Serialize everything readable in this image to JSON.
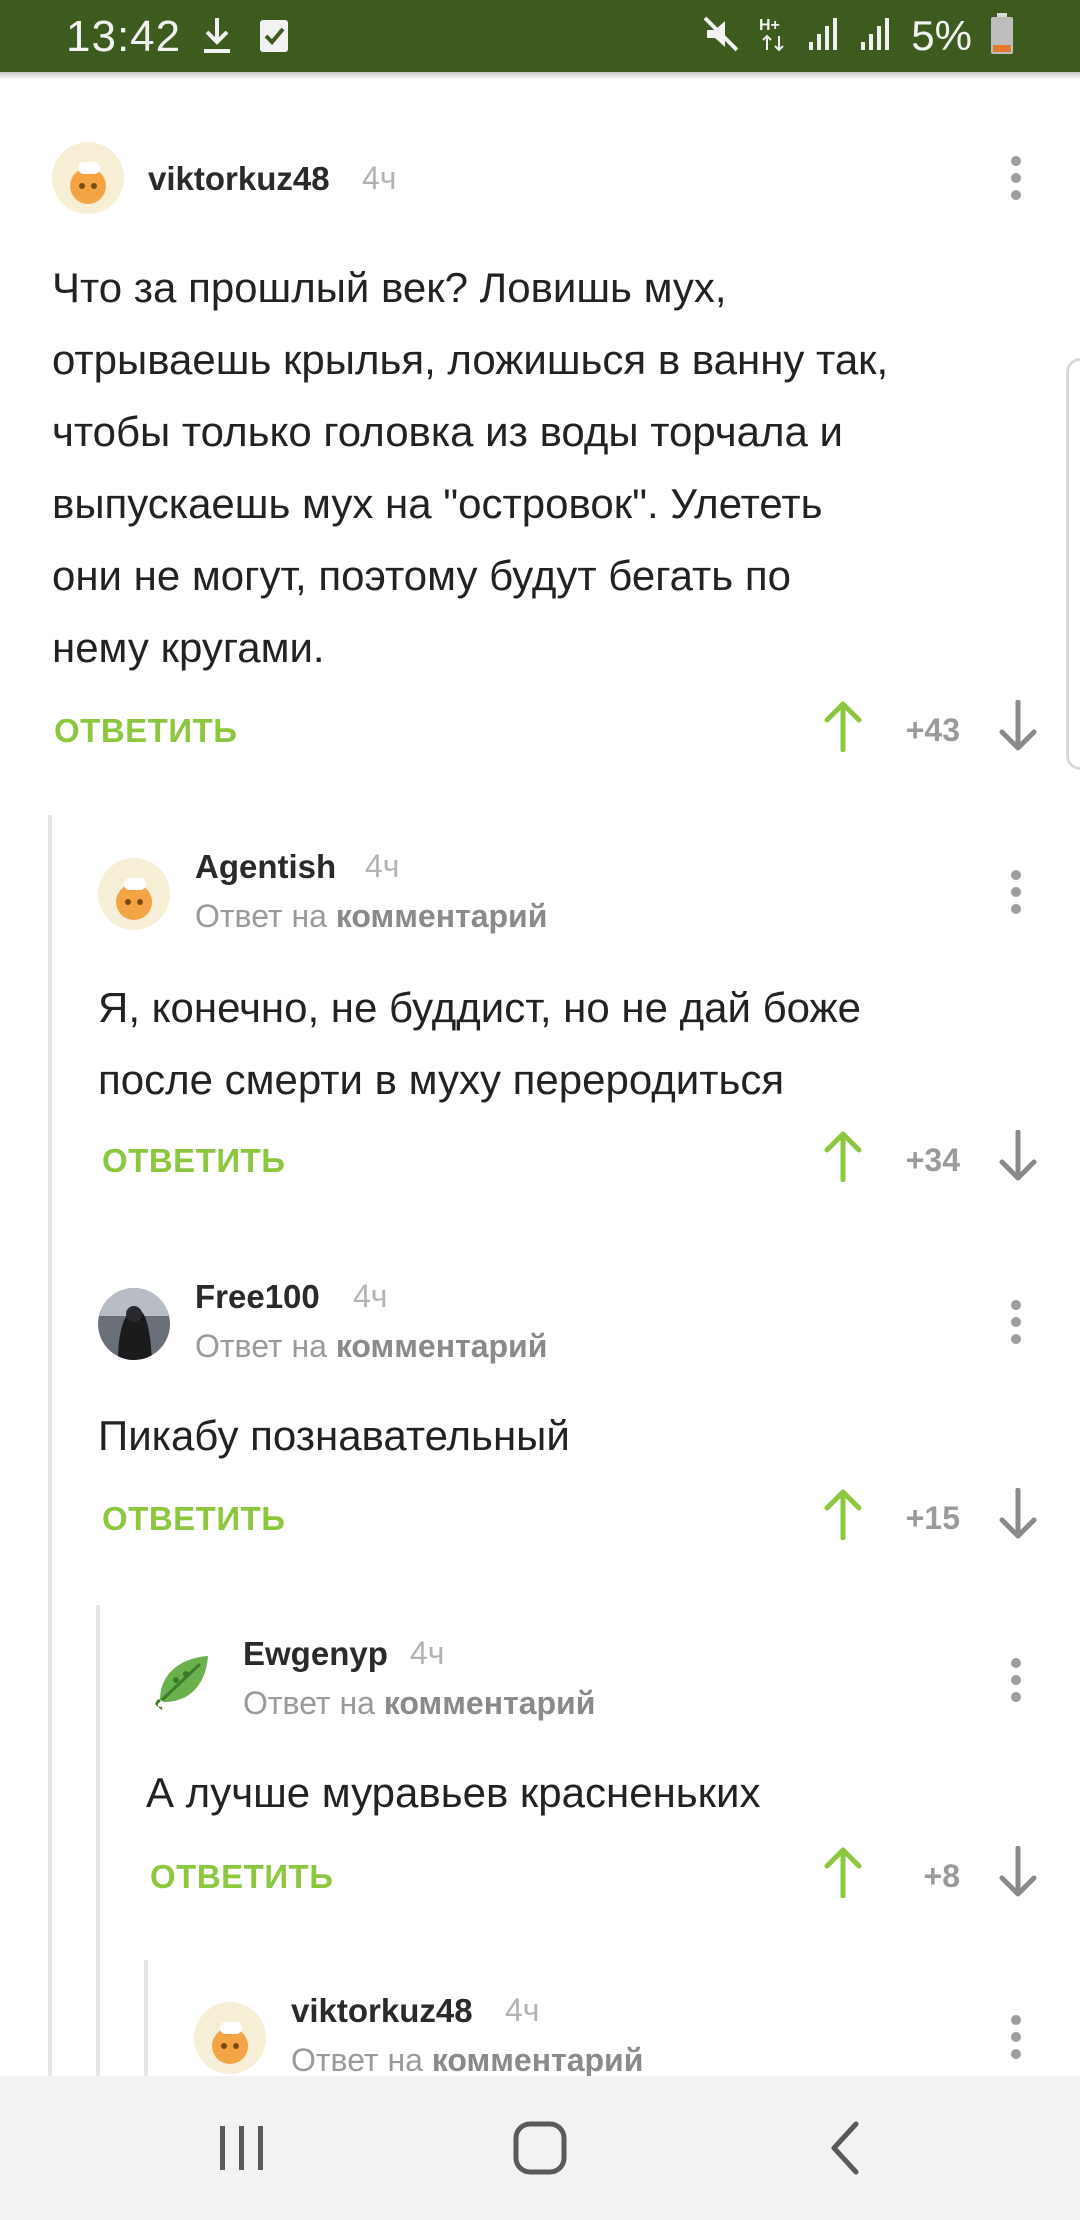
{
  "status_bar": {
    "time": "13:42",
    "battery_pct": "5%",
    "icons": [
      "download-icon",
      "check-box-icon",
      "mute-icon",
      "hplus-icon",
      "signal-icon",
      "signal-icon",
      "battery-low-icon"
    ]
  },
  "comments": [
    {
      "author": "viktorkuz48",
      "time": "4ч",
      "reply_prefix": "",
      "reply_target": "",
      "lines": [
        "Что за прошлый век? Ловишь мух,",
        "отрываешь крылья, ложишься в ванну так,",
        "чтобы только головка из воды торчала и",
        "выпускаешь мух на \"островок\". Улететь",
        "они не могут, поэтому будут бегать по",
        "нему кругами."
      ],
      "reply_label": "ОТВЕТИТЬ",
      "score": "+43"
    },
    {
      "author": "Agentish",
      "time": "4ч",
      "reply_prefix": "Ответ на",
      "reply_target": "комментарий",
      "lines": [
        "Я, конечно, не буддист, но не дай боже",
        "после смерти в муху переродиться"
      ],
      "reply_label": "ОТВЕТИТЬ",
      "score": "+34"
    },
    {
      "author": "Free100",
      "time": "4ч",
      "reply_prefix": "Ответ на",
      "reply_target": "комментарий",
      "lines": [
        "Пикабу познавательный"
      ],
      "reply_label": "ОТВЕТИТЬ",
      "score": "+15"
    },
    {
      "author": "Ewgenyp",
      "time": "4ч",
      "reply_prefix": "Ответ на",
      "reply_target": "комментарий",
      "lines": [
        "А лучше муравьев красненьких"
      ],
      "reply_label": "ОТВЕТИТЬ",
      "score": "+8"
    },
    {
      "author": "viktorkuz48",
      "time": "4ч",
      "reply_prefix": "Ответ на",
      "reply_target": "комментарий",
      "lines": [],
      "reply_label": "",
      "score": ""
    }
  ],
  "colors": {
    "status_bar": "#3d5a1f",
    "accent_green": "#8dc63f",
    "muted_text": "#9a9a9a"
  },
  "nav": {
    "icons": [
      "recent-apps-icon",
      "home-icon",
      "back-icon"
    ]
  }
}
